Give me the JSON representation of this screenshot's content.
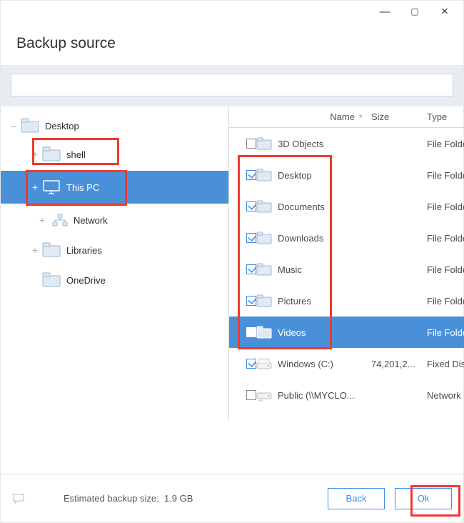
{
  "window": {
    "title": "Backup source"
  },
  "search": {
    "value": ""
  },
  "tree": {
    "root": {
      "label": "Desktop",
      "children": [
        {
          "id": "shell",
          "label": "shell",
          "icon": "folder"
        },
        {
          "id": "thispc",
          "label": "This PC",
          "icon": "monitor",
          "selected": true
        },
        {
          "id": "network",
          "label": "Network",
          "icon": "network"
        },
        {
          "id": "libraries",
          "label": "Libraries",
          "icon": "folder"
        },
        {
          "id": "onedrive",
          "label": "OneDrive",
          "icon": "folder"
        }
      ]
    }
  },
  "list": {
    "columns": {
      "name": "Name",
      "size": "Size",
      "type": "Type"
    },
    "rows": [
      {
        "checked": false,
        "icon": "folder",
        "name": "3D Objects",
        "size": "",
        "type": "File Folder"
      },
      {
        "checked": true,
        "icon": "folder",
        "name": "Desktop",
        "size": "",
        "type": "File Folder"
      },
      {
        "checked": true,
        "icon": "folder",
        "name": "Documents",
        "size": "",
        "type": "File Folder"
      },
      {
        "checked": true,
        "icon": "folder",
        "name": "Downloads",
        "size": "",
        "type": "File Folder"
      },
      {
        "checked": true,
        "icon": "folder",
        "name": "Music",
        "size": "",
        "type": "File Folder"
      },
      {
        "checked": true,
        "icon": "folder",
        "name": "Pictures",
        "size": "",
        "type": "File Folder"
      },
      {
        "checked": true,
        "icon": "folder",
        "name": "Videos",
        "size": "",
        "type": "File Folder",
        "selected": true
      },
      {
        "checked": true,
        "icon": "drive",
        "name": "Windows (C:)",
        "size": "74,201,2...",
        "type": "Fixed Disk"
      },
      {
        "checked": false,
        "icon": "netdrive",
        "name": "Public (\\\\MYCLO...",
        "size": "",
        "type": "Network"
      }
    ]
  },
  "footer": {
    "estimated_label": "Estimated backup size:",
    "estimated_value": "1.9 GB",
    "back": "Back",
    "ok": "Ok"
  }
}
